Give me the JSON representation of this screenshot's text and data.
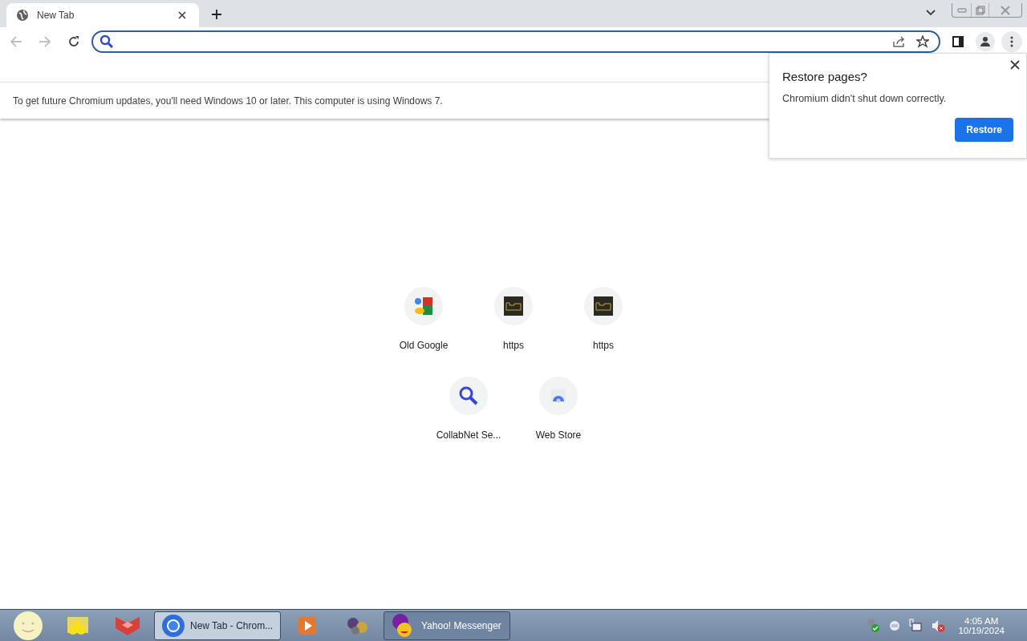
{
  "tabs": [
    {
      "title": "New Tab",
      "selected": true
    }
  ],
  "infobar": {
    "message": "To get future Chromium updates, you'll need Windows 10 or later. This computer is using Windows 7."
  },
  "restore_bubble": {
    "title": "Restore pages?",
    "message": "Chromium didn't shut down correctly.",
    "button": "Restore"
  },
  "shortcuts": [
    {
      "title": "Old Google",
      "kind": "google"
    },
    {
      "title": "https",
      "kind": "thumbnail"
    },
    {
      "title": "https",
      "kind": "thumbnail"
    },
    {
      "title": "CollabNet Se...",
      "kind": "search"
    },
    {
      "title": "Web Store",
      "kind": "webstore"
    }
  ],
  "taskbar": {
    "items": [
      {
        "kind": "smiley"
      },
      {
        "kind": "folder"
      },
      {
        "kind": "box"
      },
      {
        "kind": "chrome",
        "label": "New Tab - Chrom...",
        "selected": true
      },
      {
        "kind": "player"
      },
      {
        "kind": "people"
      },
      {
        "kind": "yahoo",
        "label": "Yahoo! Messenger",
        "selected": false
      }
    ],
    "clock": {
      "time": "4:05 AM",
      "date": "10/19/2024"
    }
  }
}
